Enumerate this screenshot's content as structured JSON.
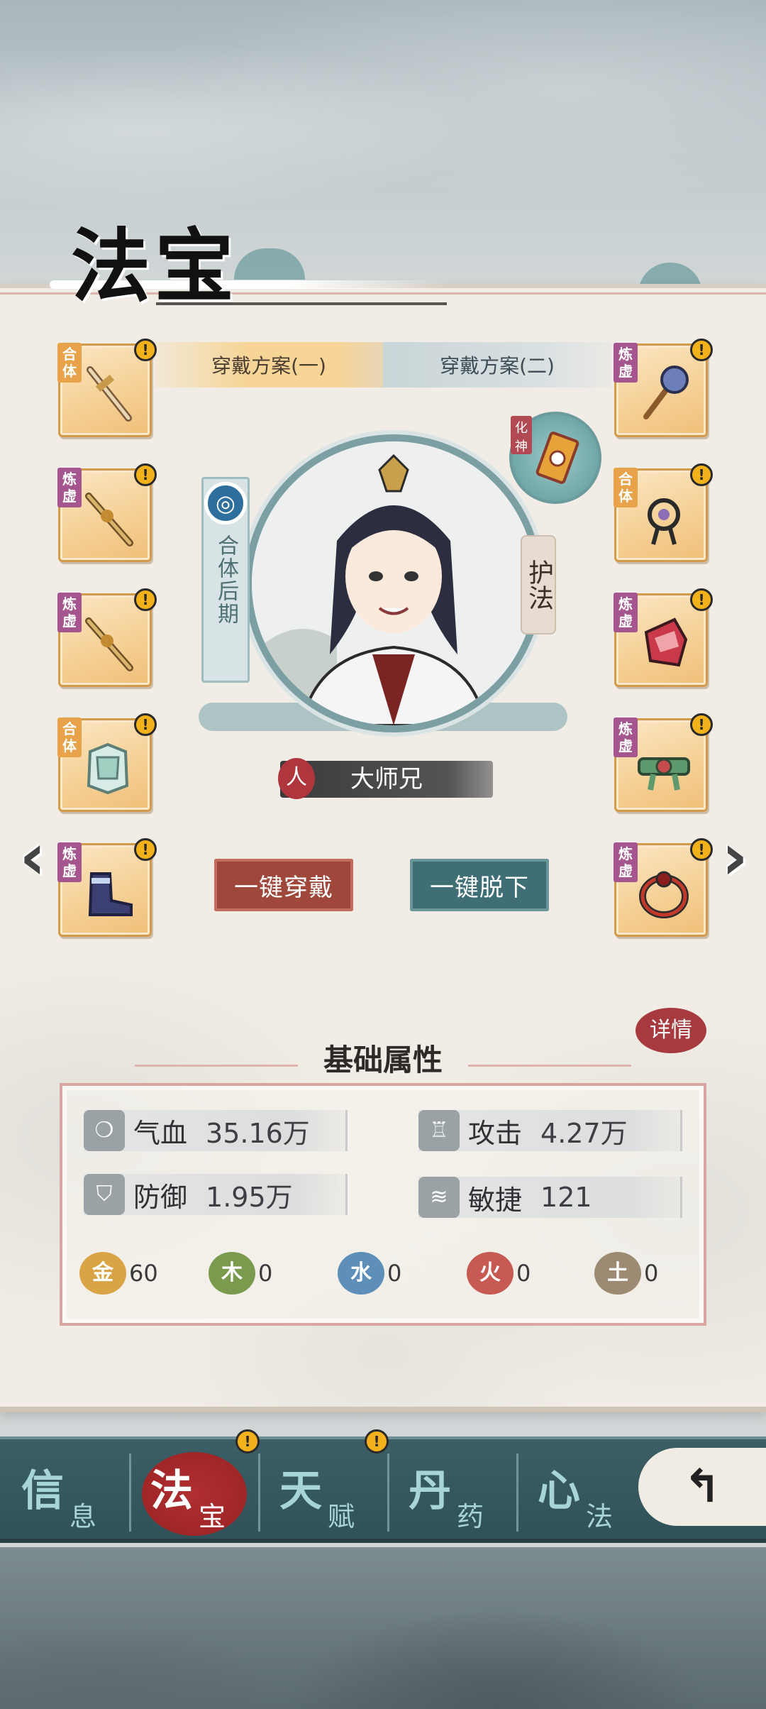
{
  "title": "法宝",
  "plans": [
    "穿戴方案(一)",
    "穿戴方案(二)"
  ],
  "left_slots": [
    {
      "tag": "合体",
      "item": "sword-icon"
    },
    {
      "tag": "炼虚",
      "item": "sword-icon"
    },
    {
      "tag": "炼虚",
      "item": "sword-icon"
    },
    {
      "tag": "合体",
      "item": "armor-icon"
    },
    {
      "tag": "炼虚",
      "item": "boots-icon"
    }
  ],
  "right_slots": [
    {
      "tag": "炼虚",
      "item": "fan-icon"
    },
    {
      "tag": "合体",
      "item": "pendant-icon"
    },
    {
      "tag": "炼虚",
      "item": "gauntlet-icon"
    },
    {
      "tag": "炼虚",
      "item": "belt-icon"
    },
    {
      "tag": "炼虚",
      "item": "ring-icon"
    }
  ],
  "character": {
    "realm": "合体后期",
    "realm_icon": "swirl-icon",
    "huashen_tag": "化神",
    "hufa": "护法",
    "race_badge": "人",
    "name": "大师兄"
  },
  "buttons": {
    "wear_all": "一键穿戴",
    "remove_all": "一键脱下"
  },
  "stats": {
    "header": "基础属性",
    "details": "详情",
    "items": [
      {
        "label": "气血",
        "value": "35.16万",
        "icon": "blood-icon"
      },
      {
        "label": "攻击",
        "value": "4.27万",
        "icon": "attack-icon"
      },
      {
        "label": "防御",
        "value": "1.95万",
        "icon": "shield-icon"
      },
      {
        "label": "敏捷",
        "value": "121",
        "icon": "wind-icon"
      }
    ],
    "elements": [
      {
        "name": "金",
        "value": "60",
        "color": "#d9a446"
      },
      {
        "name": "木",
        "value": "0",
        "color": "#7a9a4e"
      },
      {
        "name": "水",
        "value": "0",
        "color": "#5d8fb8"
      },
      {
        "name": "火",
        "value": "0",
        "color": "#c75a53"
      },
      {
        "name": "土",
        "value": "0",
        "color": "#9c8a73"
      }
    ]
  },
  "nav": [
    {
      "big": "信",
      "small": "息"
    },
    {
      "big": "法",
      "small": "宝"
    },
    {
      "big": "天",
      "small": "赋"
    },
    {
      "big": "丹",
      "small": "药"
    },
    {
      "big": "心",
      "small": "法"
    }
  ],
  "warn_mark": "!"
}
